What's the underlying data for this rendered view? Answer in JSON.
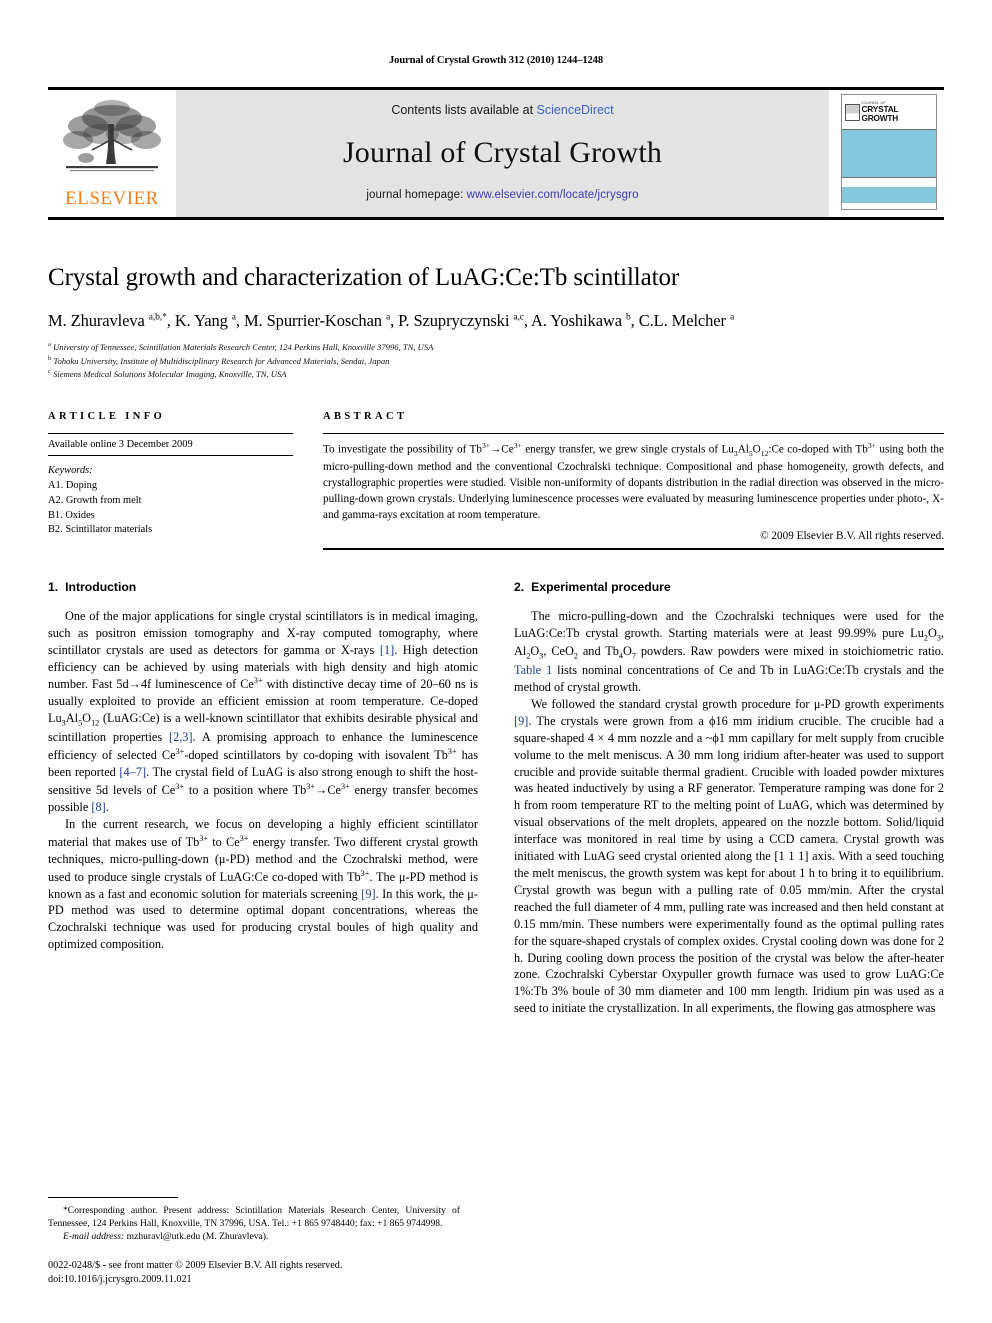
{
  "running_head": "Journal of Crystal Growth 312 (2010) 1244–1248",
  "masthead": {
    "publisher_name": "ELSEVIER",
    "contents_prefix": "Contents lists available at ",
    "contents_link": "ScienceDirect",
    "journal_name": "Journal of Crystal Growth",
    "homepage_prefix": "journal homepage: ",
    "homepage_link": "www.elsevier.com/locate/jcrysgro",
    "cover": {
      "prefix": "JOURNAL OF",
      "line1": "CRYSTAL",
      "line2": "GROWTH",
      "band_color": "#85c7dd"
    }
  },
  "article": {
    "title": "Crystal growth and characterization of LuAG:Ce:Tb scintillator",
    "authors_html": "M. Zhuravleva <sup>a,b,</sup><sup>*</sup>, K. Yang <sup>a</sup>, M. Spurrier-Koschan <sup>a</sup>, P. Szupryczynski <sup>a,c</sup>, A. Yoshikawa <sup>b</sup>, C.L. Melcher <sup>a</sup>",
    "affiliations": [
      {
        "marker": "a",
        "text": "University of Tennessee, Scintillation Materials Research Center, 124 Perkins Hall, Knoxville 37996, TN, USA"
      },
      {
        "marker": "b",
        "text": "Tohoku University, Institute of Multidisciplinary Research for Advanced Materials, Sendai, Japan"
      },
      {
        "marker": "c",
        "text": "Siemens Medical Solutions Molecular Imaging, Knoxville, TN, USA"
      }
    ]
  },
  "article_info": {
    "heading": "ARTICLE INFO",
    "history": "Available online 3 December 2009",
    "keywords_label": "Keywords:",
    "keywords": [
      "A1. Doping",
      "A2. Growth from melt",
      "B1. Oxides",
      "B2. Scintillator materials"
    ]
  },
  "abstract": {
    "heading": "ABSTRACT",
    "text_html": "To investigate the possibility of Tb<sup>3+</sup>→Ce<sup>3+</sup> energy transfer, we grew single crystals of Lu<sub>3</sub>Al<sub>5</sub>O<sub>12</sub>:Ce co-doped with Tb<sup>3+</sup> using both the micro-pulling-down method and the conventional Czochralski technique. Compositional and phase homogeneity, growth defects, and crystallographic properties were studied. Visible non-uniformity of dopants distribution in the radial direction was observed in the micro-pulling-down grown crystals. Underlying luminescence processes were evaluated by measuring luminescence properties under photo-, X- and gamma-rays excitation at room temperature.",
    "copyright": "© 2009 Elsevier B.V. All rights reserved."
  },
  "sections": [
    {
      "number": "1.",
      "heading": "Introduction",
      "paragraphs_html": [
        "One of the major applications for single crystal scintillators is in medical imaging, such as positron emission tomography and X-ray computed tomography, where scintillator crystals are used as detectors for gamma or X-rays <span class=\"ref\">[1]</span>. High detection efficiency can be achieved by using materials with high density and high atomic number. Fast 5d→4f luminescence of Ce<sup>3+</sup> with distinctive decay time of 20–60 ns is usually exploited to provide an efficient emission at room temperature. Ce-doped Lu<sub>3</sub>Al<sub>5</sub>O<sub>12</sub> (LuAG:Ce) is a well-known scintillator that exhibits desirable physical and scintillation properties <span class=\"ref\">[2,3]</span>. A promising approach to enhance the luminescence efficiency of selected Ce<sup>3+</sup>-doped scintillators by co-doping with isovalent Tb<sup>3+</sup> has been reported <span class=\"ref\">[4–7]</span>. The crystal field of LuAG is also strong enough to shift the host-sensitive 5d levels of Ce<sup>3+</sup> to a position where Tb<sup>3+</sup>→Ce<sup>3+</sup> energy transfer becomes possible <span class=\"ref\">[8]</span>.",
        "In the current research, we focus on developing a highly efficient scintillator material that makes use of Tb<sup>3+</sup> to Ce<sup>3+</sup> energy transfer. Two different crystal growth techniques, micro-pulling-down (μ-PD) method and the Czochralski method, were used to produce single crystals of LuAG:Ce co-doped with Tb<sup>3+</sup>. The μ-PD method is known as a fast and economic solution for materials screening <span class=\"ref\">[9]</span>. In this work, the μ-PD method was used to determine optimal dopant concentrations, whereas the Czochralski technique was used for producing crystal boules of high quality and optimized composition."
      ]
    },
    {
      "number": "2.",
      "heading": "Experimental procedure",
      "paragraphs_html": [
        "The micro-pulling-down and the Czochralski techniques were used for the LuAG:Ce:Tb crystal growth. Starting materials were at least 99.99% pure Lu<sub>2</sub>O<sub>3</sub>, Al<sub>2</sub>O<sub>3</sub>, CeO<sub>2</sub> and Tb<sub>4</sub>O<sub>7</sub> powders. Raw powders were mixed in stoichiometric ratio. <span class=\"ref\">Table 1</span> lists nominal concentrations of Ce and Tb in LuAG:Ce:Tb crystals and the method of crystal growth.",
        "We followed the standard crystal growth procedure for μ-PD growth experiments <span class=\"ref\">[9]</span>. The crystals were grown from a ϕ16 mm iridium crucible. The crucible had a square-shaped 4 × 4 mm nozzle and a ~ϕ1 mm capillary for melt supply from crucible volume to the melt meniscus. A 30 mm long iridium after-heater was used to support crucible and provide suitable thermal gradient. Crucible with loaded powder mixtures was heated inductively by using a RF generator. Temperature ramping was done for 2 h from room temperature RT to the melting point of LuAG, which was determined by visual observations of the melt droplets, appeared on the nozzle bottom. Solid/liquid interface was monitored in real time by using a CCD camera. Crystal growth was initiated with LuAG seed crystal oriented along the [1 1 1] axis. With a seed touching the melt meniscus, the growth system was kept for about 1 h to bring it to equilibrium. Crystal growth was begun with a pulling rate of 0.05 mm/min. After the crystal reached the full diameter of 4 mm, pulling rate was increased and then held constant at 0.15 mm/min. These numbers were experimentally found as the optimal pulling rates for the square-shaped crystals of complex oxides. Crystal cooling down was done for 2 h. During cooling down process the position of the crystal was below the after-heater zone. Czochralski Cyberstar Oxypuller growth furnace was used to grow LuAG:Ce 1%:Tb 3% boule of 30 mm diameter and 100 mm length. Iridium pin was used as a seed to initiate the crystallization. In all experiments, the flowing gas atmosphere was"
      ]
    }
  ],
  "footnotes": {
    "corresponding_html": "*Corresponding author. Present address: Scintillation Materials Research Center, University of Tennessee, 124 Perkins Hall, Knoxville, TN 37996, USA. Tel.: +1 865 9748440; fax: +1 865 9744998.",
    "email_label": "E-mail address:",
    "email_text": "mzhuravl@utk.edu (M. Zhuravleva).",
    "imprint_line1": "0022-0248/$ - see front matter © 2009 Elsevier B.V. All rights reserved.",
    "imprint_line2": "doi:10.1016/j.jcrysgro.2009.11.021"
  }
}
